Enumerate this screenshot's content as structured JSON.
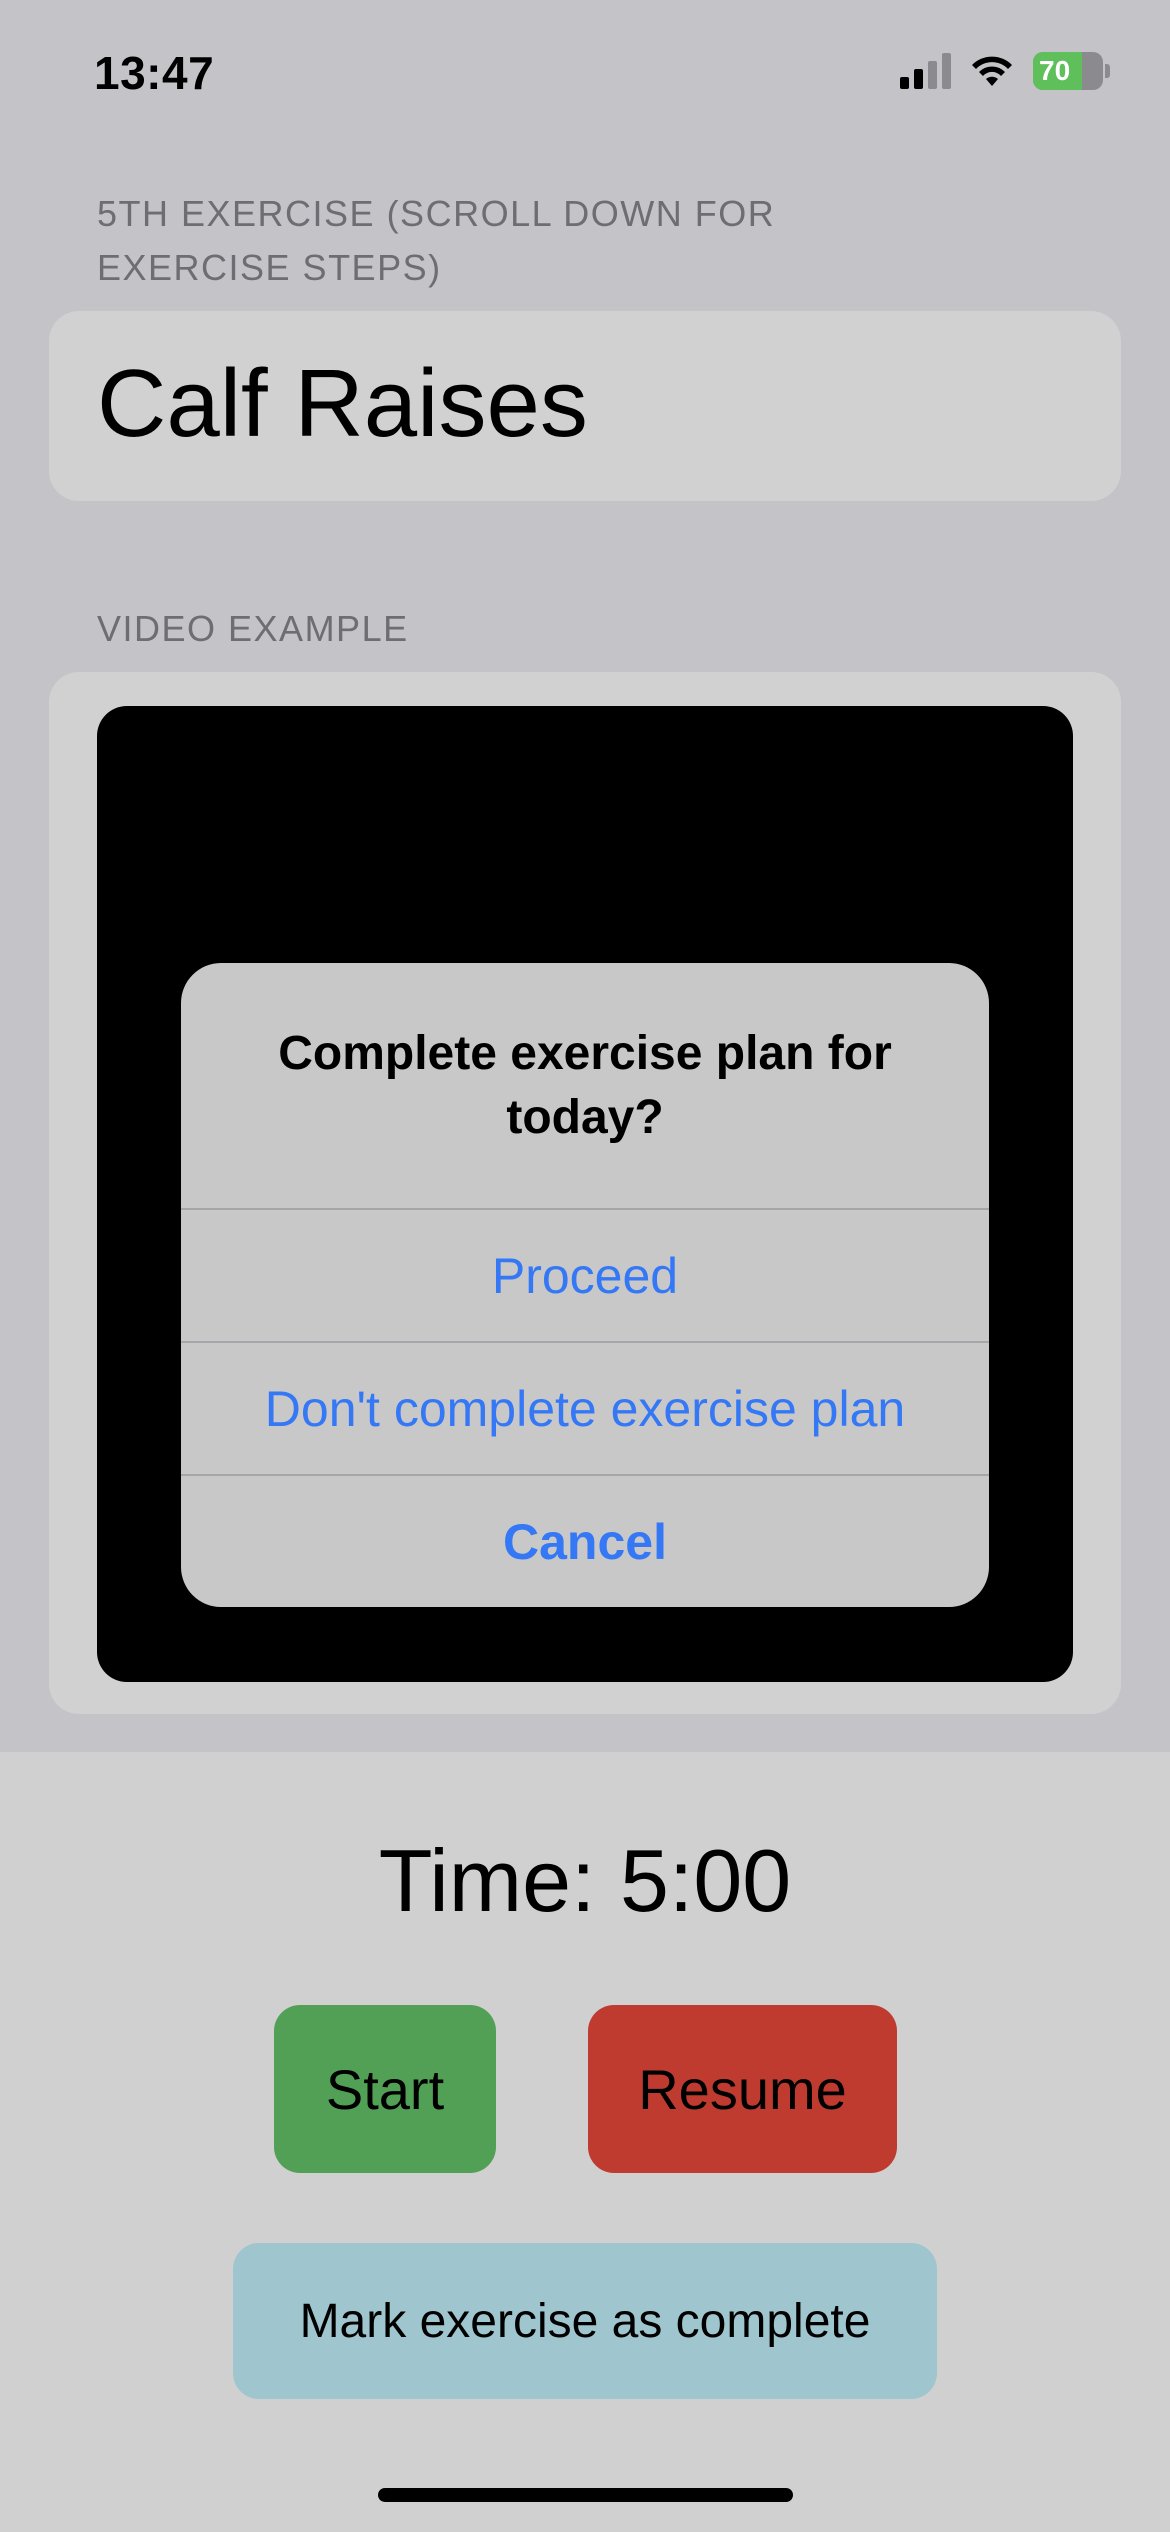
{
  "status_bar": {
    "time": "13:47",
    "battery": "70",
    "battery_color": "#5fbf5a"
  },
  "exercise_section": {
    "caption": "5TH EXERCISE (SCROLL DOWN FOR EXERCISE STEPS)",
    "name": "Calf Raises"
  },
  "video_section": {
    "caption": "VIDEO EXAMPLE"
  },
  "alert": {
    "title": "Complete exercise plan for today?",
    "buttons": [
      "Proceed",
      "Don't complete exercise plan",
      "Cancel"
    ],
    "button_color": "#3478f6"
  },
  "timer": {
    "label": "Time: 5:00"
  },
  "controls": {
    "start_label": "Start",
    "start_color": "#52a055",
    "resume_label": "Resume",
    "resume_color": "#bf3b30",
    "complete_label": "Mark exercise as complete",
    "complete_color": "#9fc5ce"
  }
}
